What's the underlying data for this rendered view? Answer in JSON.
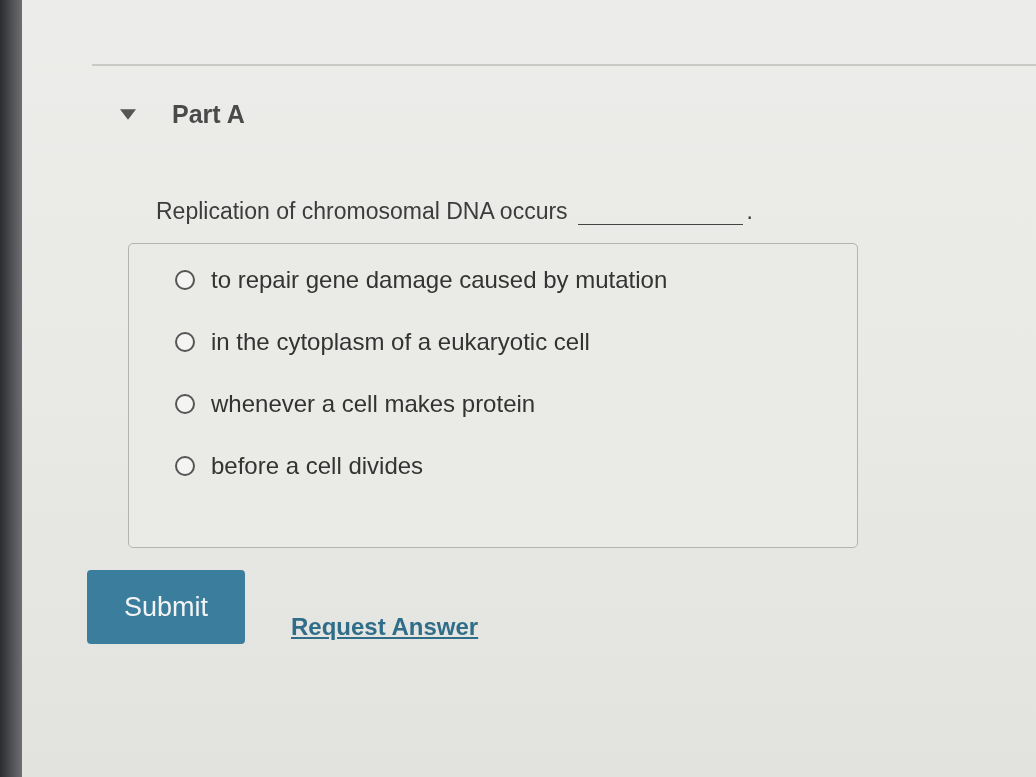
{
  "part": {
    "title": "Part A",
    "expanded": true
  },
  "question": {
    "prompt": "Replication of chromosomal DNA occurs",
    "after_blank": "."
  },
  "options": [
    {
      "label": "to repair gene damage caused by mutation",
      "selected": false
    },
    {
      "label": "in the cytoplasm of a eukaryotic cell",
      "selected": false
    },
    {
      "label": "whenever a cell makes protein",
      "selected": false
    },
    {
      "label": "before a cell divides",
      "selected": false
    }
  ],
  "buttons": [
    {
      "kind": "primary",
      "label": "Submit"
    },
    {
      "kind": "link",
      "label": "Request Answer"
    }
  ]
}
